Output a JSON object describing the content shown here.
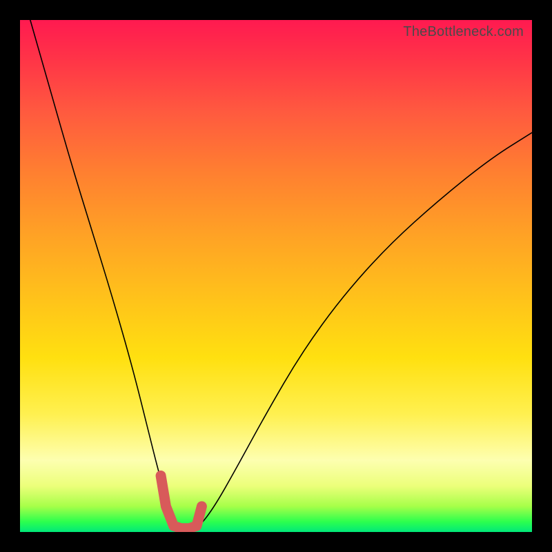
{
  "attribution": "TheBottleneck.com",
  "chart_data": {
    "type": "line",
    "title": "",
    "xlabel": "",
    "ylabel": "",
    "xlim": [
      0,
      100
    ],
    "ylim": [
      0,
      100
    ],
    "series": [
      {
        "name": "bottleneck-curve",
        "x": [
          2,
          6,
          10,
          14,
          18,
          22,
          25,
          27,
          29,
          31,
          33,
          35,
          38,
          42,
          48,
          55,
          63,
          72,
          82,
          92,
          100
        ],
        "y": [
          100,
          86,
          72,
          59,
          46,
          32,
          20,
          12,
          5,
          1,
          0.5,
          1,
          5,
          12,
          23,
          35,
          46,
          56,
          65,
          73,
          78
        ]
      }
    ],
    "marker": {
      "name": "optimal-range",
      "x": [
        27.5,
        28.5,
        30,
        31.5,
        33,
        34.5,
        35.5
      ],
      "y": [
        11,
        5,
        1.2,
        0.7,
        0.7,
        1.2,
        5
      ]
    },
    "grid": false,
    "legend": false
  }
}
